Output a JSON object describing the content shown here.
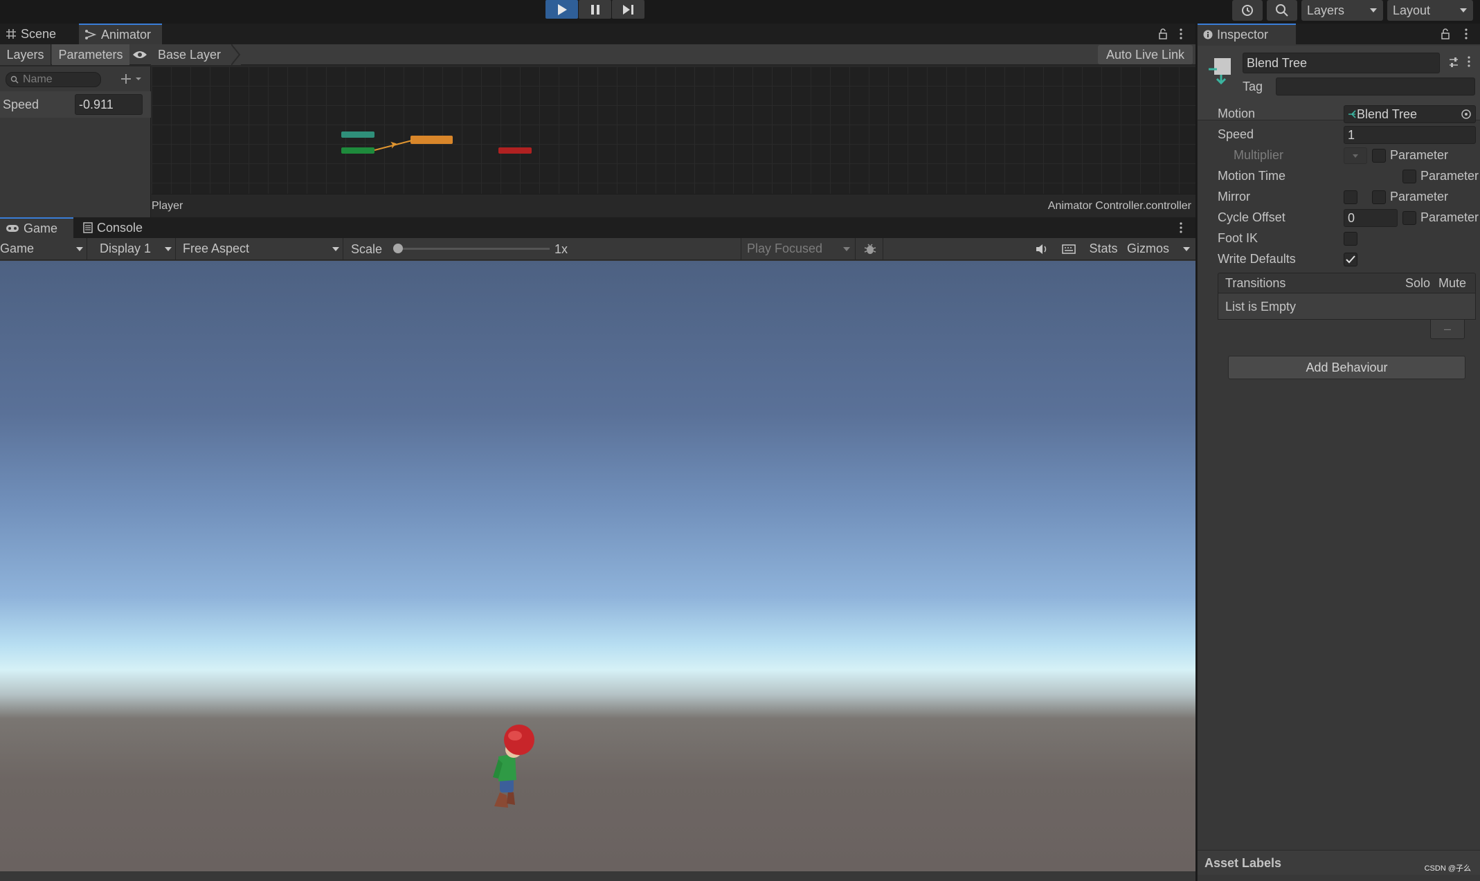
{
  "toolbar": {
    "layers_label": "Layers",
    "layout_label": "Layout"
  },
  "animator": {
    "tabs": [
      {
        "label": "Scene",
        "icon": "grid-icon"
      },
      {
        "label": "Animator",
        "icon": "animator-icon"
      }
    ],
    "subtabs": {
      "layers": "Layers",
      "parameters": "Parameters"
    },
    "breadcrumb": "Base Layer",
    "auto_live_link": "Auto Live Link",
    "search_placeholder": "Name",
    "parameter": {
      "name": "Speed",
      "value": "-0.911"
    },
    "footer_left": "Player",
    "footer_right": "Animator Controller.controller"
  },
  "game": {
    "tabs": [
      {
        "label": "Game",
        "icon": "gamepad-icon"
      },
      {
        "label": "Console",
        "icon": "console-icon"
      }
    ],
    "view_select": "Game",
    "display_select": "Display 1",
    "aspect_select": "Free Aspect",
    "scale_label": "Scale",
    "scale_value": "1x",
    "play_focused": "Play Focused",
    "stats": "Stats",
    "gizmos": "Gizmos"
  },
  "inspector": {
    "tab_label": "Inspector",
    "name_value": "Blend Tree",
    "tag_label": "Tag",
    "motion_label": "Motion",
    "motion_value": "Blend Tree",
    "speed_label": "Speed",
    "speed_value": "1",
    "multiplier_label": "Multiplier",
    "parameter_label": "Parameter",
    "motion_time_label": "Motion Time",
    "mirror_label": "Mirror",
    "cycle_offset_label": "Cycle Offset",
    "cycle_offset_value": "0",
    "foot_ik_label": "Foot IK",
    "write_defaults_label": "Write Defaults",
    "write_defaults_checked": true,
    "transitions_label": "Transitions",
    "solo_label": "Solo",
    "mute_label": "Mute",
    "list_empty": "List is Empty",
    "remove_symbol": "–",
    "add_behaviour": "Add Behaviour",
    "asset_labels": "Asset Labels",
    "watermark": "CSDN @子么"
  },
  "colors": {
    "play_active": "#2f5f98",
    "selection_accent": "#3a7ed8",
    "state_orange": "#d9862a",
    "state_green": "#1e8a3c",
    "state_teal": "#2f8f7a",
    "state_red": "#b02121"
  }
}
